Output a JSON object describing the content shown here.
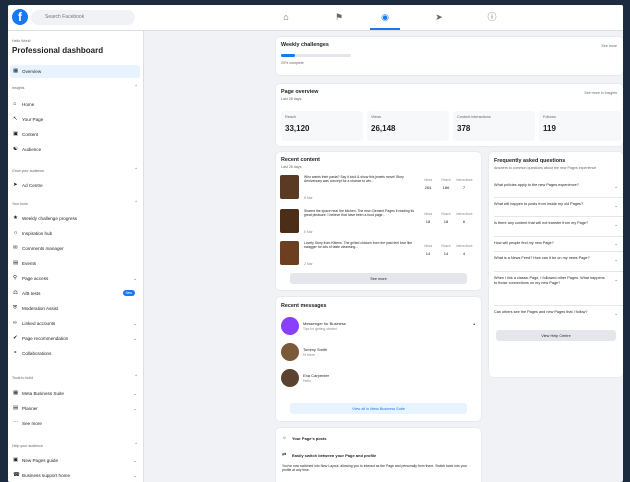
{
  "topbar": {
    "search_placeholder": "Search Facebook",
    "icons": [
      "home-icon",
      "pages-icon",
      "dashboard-icon",
      "megaphone-icon",
      "help-icon"
    ]
  },
  "sidebar": {
    "eyebrow": "Hello World",
    "title": "Professional dashboard",
    "overview": "Overview",
    "sections": [
      {
        "label": "Insights",
        "items": [
          "Home",
          "Your Page",
          "Content",
          "Audience"
        ]
      },
      {
        "label": "Grow your audience",
        "items": [
          "Ad Centre"
        ]
      },
      {
        "label": "Your tools",
        "items": [
          "Weekly challenge progress",
          "Inspiration hub",
          "Comments manager",
          "Events",
          "Page access",
          "A/B tests",
          "Moderation Assist",
          "Linked accounts",
          "Page recommendation",
          "Collaborations"
        ]
      },
      {
        "label": "Tools to build",
        "items": [
          "Meta Business Suite",
          "Planner",
          "See more"
        ]
      },
      {
        "label": "Help your audience",
        "items": [
          "New Pages guide",
          "Business support home"
        ]
      }
    ],
    "ab_badge": "New"
  },
  "weekly": {
    "title": "Weekly challenges",
    "sub": "20% complete",
    "link": "See more",
    "progress": 0.2,
    "bar_color": "#1877f2"
  },
  "overview": {
    "title": "Page overview",
    "sub": "Last 28 days",
    "link": "See more in Insights",
    "stats": [
      {
        "label": "Reach",
        "value": "33,120"
      },
      {
        "label": "Views",
        "value": "26,148"
      },
      {
        "label": "Content interactions",
        "value": "378"
      },
      {
        "label": "Follows",
        "value": "119"
      }
    ]
  },
  "recent": {
    "title": "Recent content",
    "sub": "Last 28 days",
    "cols": [
      "Views",
      "Reach",
      "Interactions"
    ],
    "posts": [
      {
        "text": "Who wants their pasta? Say it loud & show this jewels move! Story Anniversary was concept for a chance to win...",
        "meta": "8 Mar",
        "v": "264",
        "r": "186",
        "i": "7"
      },
      {
        "text": "Shared the space near the kitchen. The new-Clement Pages it reading its great pleasure. I believe that have been a food page...",
        "meta": "6 Mar",
        "v": "18",
        "r": "18",
        "i": "6"
      },
      {
        "text": "Lovely Story from Kittens. The grilled chicken from the past feel love like swagger for lots of taste cleansing...",
        "meta": "2 Mar",
        "v": "14",
        "r": "14",
        "i": "4"
      }
    ],
    "see_more": "See more"
  },
  "messages": {
    "title": "Recent messages",
    "items": [
      {
        "name": "Messenger for Business",
        "meta": "Tips for getting started",
        "avatar": "messenger-icon"
      },
      {
        "name": "Tommy Smith",
        "meta": "Hi there"
      },
      {
        "name": "Ena Carpenter",
        "meta": "Hello"
      }
    ],
    "link_btn": "View all in Meta Business Suite"
  },
  "faq": {
    "title": "Frequently asked questions",
    "sub": "Answers to common questions about the new Pages experience",
    "items": [
      "What policies apply to the new Pages experience?",
      "What will happen to posts from inside my old Pages?",
      "Is there any content that will not transfer from my Page?",
      "How will people find my new Page?",
      "What is a News Feed? How can it be on my news Page?",
      "When I link a classic Page, I followed other Pages. What happens to those connections on my new Page?",
      "Can others see the Pages and new Pages that I follow?"
    ],
    "button": "View Help Centre"
  },
  "tips": {
    "header": "Your Page's posts",
    "title": "Easily switch between your Page and profile",
    "body": "You've now switched into New Layout, allowing you to interact as the Page and personally from there. Switch back into your profile at any time."
  }
}
